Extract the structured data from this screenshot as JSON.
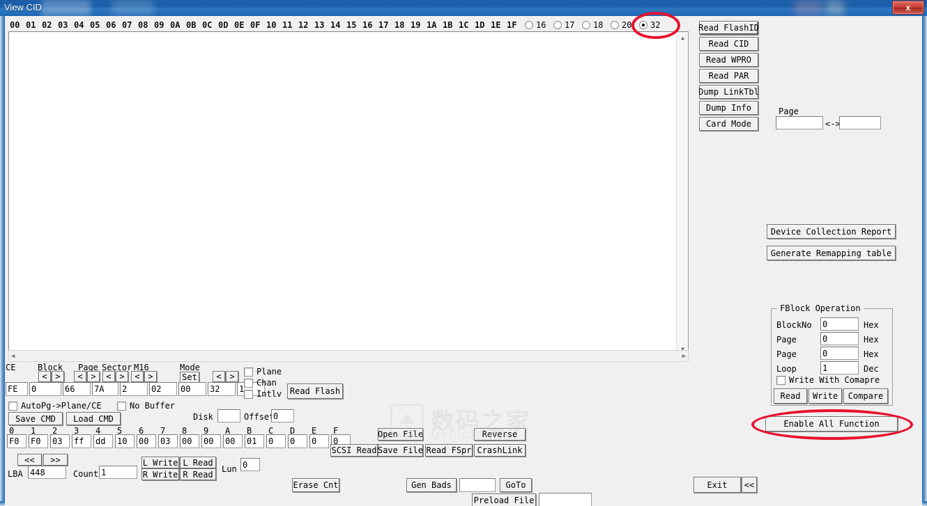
{
  "window": {
    "title": "View CID",
    "close_label": "x"
  },
  "hex_viewer": {
    "columns": [
      "00",
      "01",
      "02",
      "03",
      "04",
      "05",
      "06",
      "07",
      "08",
      "09",
      "0A",
      "0B",
      "0C",
      "0D",
      "0E",
      "0F",
      "10",
      "11",
      "12",
      "13",
      "14",
      "15",
      "16",
      "17",
      "18",
      "19",
      "1A",
      "1B",
      "1C",
      "1D",
      "1E",
      "1F"
    ],
    "content": ""
  },
  "width_radios": {
    "options": [
      {
        "label": "16",
        "selected": false
      },
      {
        "label": "17",
        "selected": false
      },
      {
        "label": "18",
        "selected": false
      },
      {
        "label": "20",
        "selected": false
      },
      {
        "label": "32",
        "selected": true
      }
    ]
  },
  "right_panel": {
    "buttons": [
      {
        "label": "Read FlashID"
      },
      {
        "label": "Read CID"
      },
      {
        "label": "Read WPRO"
      },
      {
        "label": "Read PAR"
      },
      {
        "label": "Dump LinkTbl"
      },
      {
        "label": "Dump Info"
      },
      {
        "label": "Card Mode"
      }
    ],
    "page_label": "Page",
    "page_from": "",
    "page_sep": "<->",
    "page_to": "",
    "device_collection_report": "Device Collection Report",
    "generate_remapping_table": "Generate Remapping table"
  },
  "fblock": {
    "title": "FBlock Operation",
    "rows": [
      {
        "label": "BlockNo",
        "value": "0",
        "unit": "Hex"
      },
      {
        "label": "Page",
        "value": "0",
        "unit": "Hex"
      },
      {
        "label": "Page",
        "value": "0",
        "unit": "Hex"
      },
      {
        "label": "Loop",
        "value": "1",
        "unit": "Dec"
      }
    ],
    "write_with_compare": {
      "label": "Write With Comapre",
      "checked": false
    },
    "buttons": [
      "Read",
      "Write",
      "Compare"
    ]
  },
  "enable_all": {
    "label": "Enable All Function"
  },
  "footer": {
    "exit_label": "Exit",
    "collapse_label": "<<"
  },
  "params": {
    "headers": [
      "CE",
      "Block",
      "Page",
      "Sector",
      "M16",
      "Mode"
    ],
    "spin_prev": "<",
    "spin_next": ">",
    "set_label": "Set",
    "fields": [
      {
        "name": "ce",
        "value": "FE"
      },
      {
        "name": "block1",
        "value": "0"
      },
      {
        "name": "block2",
        "value": "66"
      },
      {
        "name": "page",
        "value": "7A"
      },
      {
        "name": "sector",
        "value": "2"
      },
      {
        "name": "m16a",
        "value": "02"
      },
      {
        "name": "m16b",
        "value": "00"
      },
      {
        "name": "mode",
        "value": "32"
      },
      {
        "name": "modeb",
        "value": "1"
      }
    ]
  },
  "checkboxes": {
    "autopg": {
      "label": "AutoPg->Plane/CE",
      "checked": false
    },
    "nobuffer": {
      "label": "No Buffer",
      "checked": false
    },
    "plane": {
      "label": "Plane",
      "checked": false
    },
    "chan": {
      "label": "Chan",
      "checked": false
    },
    "intlv": {
      "label": "Intlv",
      "checked": false
    }
  },
  "cmd": {
    "save_label": "Save CMD",
    "load_label": "Load CMD",
    "read_flash_label": "Read Flash",
    "disk_label": "Disk",
    "disk_value": "",
    "offset_label": "Offset",
    "offset_value": "0",
    "columns": [
      "0",
      "1",
      "2",
      "3",
      "4",
      "5",
      "6",
      "7",
      "8",
      "9",
      "A",
      "B",
      "C",
      "D",
      "E",
      "F"
    ],
    "values": [
      "F0",
      "F0",
      "03",
      "ff",
      "dd",
      "10",
      "00",
      "03",
      "00",
      "00",
      "00",
      "01",
      "0",
      "0",
      "0",
      "0"
    ]
  },
  "lba": {
    "prev_label": "<<",
    "next_label": ">>",
    "lba_label": "LBA",
    "lba_value": "448",
    "count_label": "Count",
    "count_value": "1",
    "l_write": "L Write",
    "l_read": "L Read",
    "r_write": "R Write",
    "r_read": "R Read",
    "lun_label": "Lun",
    "lun_value": "0"
  },
  "file_ops": {
    "open_file": "Open File",
    "reverse": "Reverse",
    "scsi_read": "SCSI Read",
    "save_file": "Save File",
    "read_fspr": "Read FSpr",
    "crash_link": "CrashLink"
  },
  "bottom_ops": {
    "erase_cnt": "Erase Cnt",
    "gen_bads": "Gen Bads",
    "gen_bads_value": "",
    "goto": "GoTo",
    "preload_file": "Preload File",
    "preload_value": ""
  },
  "watermark": {
    "cn": "数码之家",
    "en": "MYDIGIT.NET"
  },
  "annotations": {
    "highlight_radio_32": "32",
    "highlight_enable_all": "Enable All Function"
  },
  "colors": {
    "titlebar": "#1d64ae",
    "annotation_red": "#e8112d",
    "face": "#f0f0f0"
  }
}
